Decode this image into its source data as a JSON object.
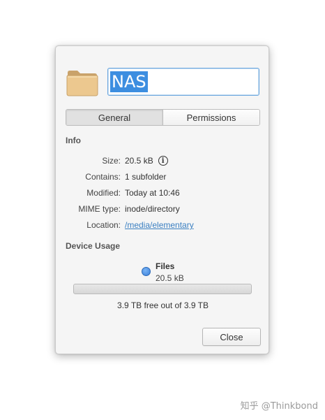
{
  "dialog": {
    "name_value": "NAS",
    "tabs": [
      {
        "label": "General",
        "active": true
      },
      {
        "label": "Permissions",
        "active": false
      }
    ],
    "info": {
      "title": "Info",
      "rows": [
        {
          "key": "Size:",
          "value": "20.5 kB"
        },
        {
          "key": "Contains:",
          "value": "1 subfolder"
        },
        {
          "key": "Modified:",
          "value": "Today at 10:46"
        },
        {
          "key": "MIME type:",
          "value": "inode/directory"
        },
        {
          "key": "Location:",
          "value": "/media/elementary"
        }
      ],
      "info_icon": "info-circle-icon"
    },
    "device_usage": {
      "title": "Device Usage",
      "legend_name": "Files",
      "legend_size": "20.5 kB",
      "used_fraction": 0.0,
      "free_text": "3.9 TB free out of 3.9 TB"
    },
    "close_label": "Close"
  },
  "colors": {
    "accent": "#3d8ee0",
    "link": "#3a7fc1",
    "folder": "#e9c48a"
  },
  "icons": {
    "folder": "folder-icon",
    "info": "info-circle-icon",
    "legend": "legend-dot-icon"
  },
  "watermark": "知乎 @Thinkbond"
}
